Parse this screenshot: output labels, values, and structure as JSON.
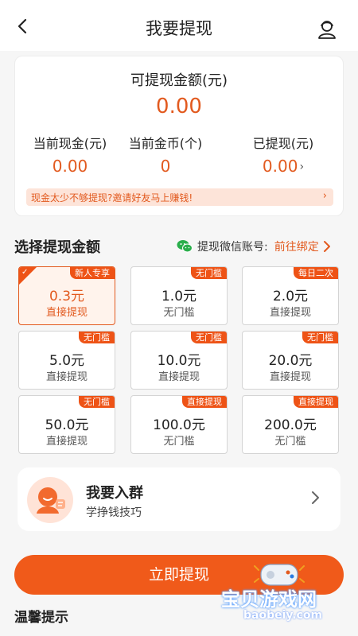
{
  "header": {
    "title": "我要提现"
  },
  "summary": {
    "label": "可提现金额(元)",
    "amount": "0.00",
    "stats": [
      {
        "label": "当前现金(元)",
        "value": "0.00"
      },
      {
        "label": "当前金币(个)",
        "value": "0"
      },
      {
        "label": "已提现(元)",
        "value": "0.00"
      }
    ],
    "invite_text": "现金太少不够提现?邀请好友马上赚钱!"
  },
  "section": {
    "title": "选择提现金额",
    "wechat_label": "提现微信账号:",
    "wechat_action": "前往绑定"
  },
  "options": [
    {
      "tag": "新人专享",
      "amount": "0.3元",
      "sub": "直接提现",
      "selected": true
    },
    {
      "tag": "无门槛",
      "amount": "1.0元",
      "sub": "无门槛",
      "selected": false
    },
    {
      "tag": "每日二次",
      "amount": "2.0元",
      "sub": "直接提现",
      "selected": false
    },
    {
      "tag": "无门槛",
      "amount": "5.0元",
      "sub": "直接提现",
      "selected": false
    },
    {
      "tag": "无门槛",
      "amount": "10.0元",
      "sub": "直接提现",
      "selected": false
    },
    {
      "tag": "无门槛",
      "amount": "20.0元",
      "sub": "直接提现",
      "selected": false
    },
    {
      "tag": "无门槛",
      "amount": "50.0元",
      "sub": "直接提现",
      "selected": false
    },
    {
      "tag": "直接提现",
      "amount": "100.0元",
      "sub": "无门槛",
      "selected": false
    },
    {
      "tag": "直接提现",
      "amount": "200.0元",
      "sub": "无门槛",
      "selected": false
    }
  ],
  "group": {
    "title": "我要入群",
    "subtitle": "学挣钱技巧"
  },
  "submit_label": "立即提现",
  "tips_title": "温馨提示",
  "watermark": {
    "cn": "宝贝游戏网",
    "en": "baobeiy.com"
  },
  "colors": {
    "accent": "#f05a1a",
    "tag": "#ee5316",
    "invite_bg": "#fde4d9"
  },
  "icons": {
    "back": "chevron-left-icon",
    "user": "customer-service-icon",
    "wechat": "wechat-icon"
  }
}
